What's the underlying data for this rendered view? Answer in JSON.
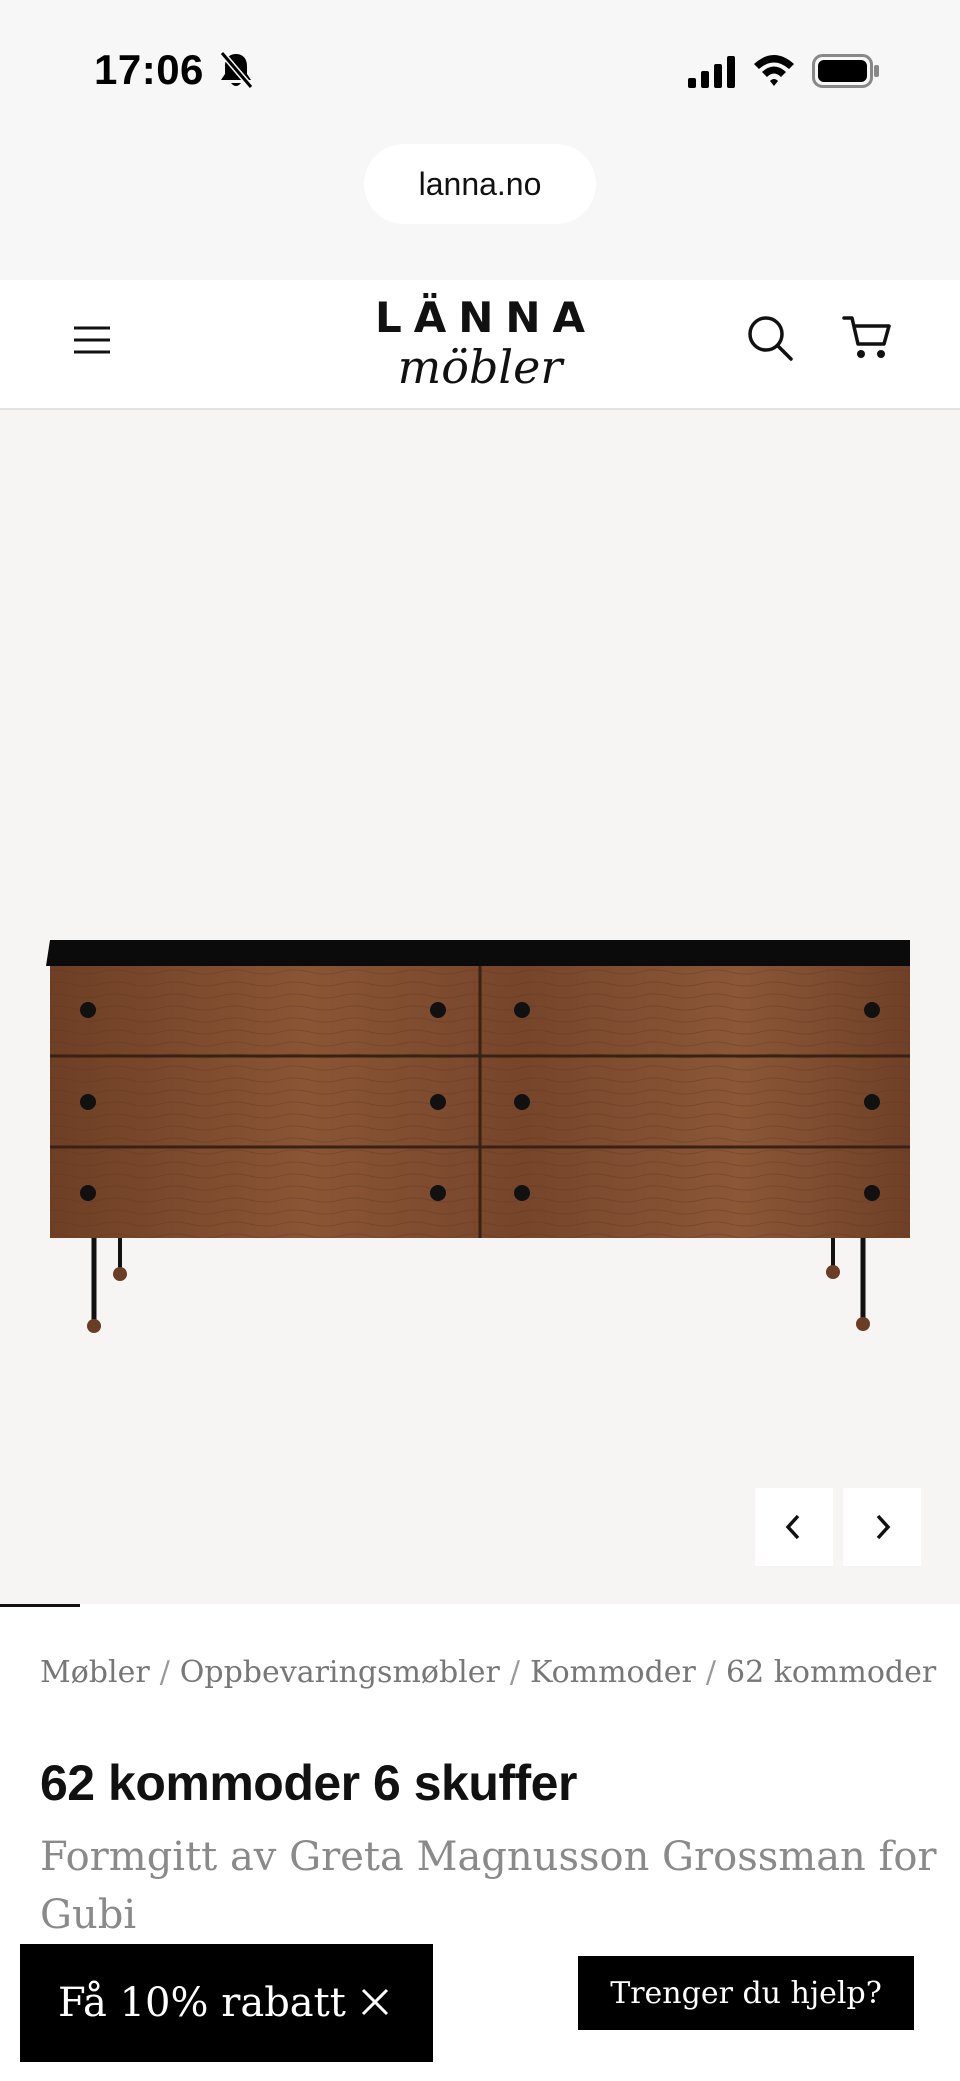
{
  "status_bar": {
    "time": "17:06",
    "icons": [
      "bell-muted-icon",
      "signal-icon",
      "wifi-icon",
      "battery-icon"
    ]
  },
  "browser": {
    "url": "lanna.no"
  },
  "header": {
    "logo_top": "LÄNNA",
    "logo_bottom": "möbler",
    "icons": [
      "menu-icon",
      "search-icon",
      "cart-icon"
    ]
  },
  "gallery": {
    "prev_icon": "chevron-left-icon",
    "next_icon": "chevron-right-icon",
    "colors": {
      "background": "#f6f5f3",
      "wood": "#7a4a2d",
      "top": "#0c0c0c"
    }
  },
  "breadcrumb": {
    "items": [
      "Møbler",
      "Oppbevaringsmøbler",
      "Kommoder",
      "62 kommoder"
    ],
    "separator": "/"
  },
  "product": {
    "title": "62 kommoder 6 skuffer",
    "subtitle": "Formgitt av Greta Magnusson Grossman for Gubi"
  },
  "popups": {
    "discount_label": "Få 10% rabatt",
    "help_label": "Trenger du hjelp?"
  }
}
